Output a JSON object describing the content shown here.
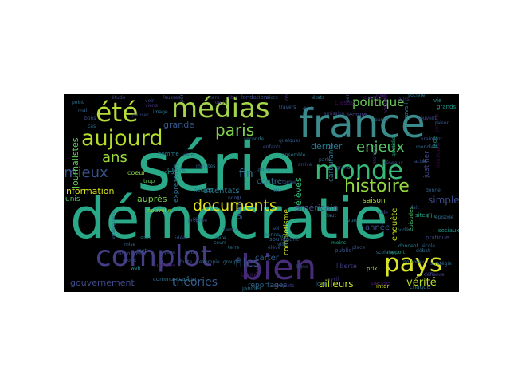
{
  "word_cloud": {
    "words": [
      {
        "text": "série",
        "color": "#2aa988"
      },
      {
        "text": "démocratie",
        "color": "#2aa988"
      },
      {
        "text": "france",
        "color": "#3b8a8c"
      },
      {
        "text": "complot",
        "color": "#433e85"
      },
      {
        "text": "bien",
        "color": "#472c7a"
      },
      {
        "text": "médias",
        "color": "#a3d44a"
      },
      {
        "text": "été",
        "color": "#b7de38"
      },
      {
        "text": "monde",
        "color": "#37b879"
      },
      {
        "text": "pays",
        "color": "#d9e32a"
      },
      {
        "text": "aujourd",
        "color": "#b5de2b"
      },
      {
        "text": "histoire",
        "color": "#94d640"
      },
      {
        "text": "documents",
        "color": "#e2e418"
      },
      {
        "text": "mieux",
        "color": "#3a518a"
      },
      {
        "text": "paris",
        "color": "#7fd34e"
      },
      {
        "text": "enjeux",
        "color": "#56c667"
      },
      {
        "text": "ans",
        "color": "#9bd93c"
      },
      {
        "text": "politique",
        "color": "#6ccd5a"
      },
      {
        "text": "théories",
        "color": "#365c8d"
      },
      {
        "text": "files",
        "color": "#3c508b"
      },
      {
        "text": "vérité",
        "color": "#b5de2b"
      },
      {
        "text": "ailleurs",
        "color": "#c4e021"
      },
      {
        "text": "simple",
        "color": "#3e4989"
      },
      {
        "text": "gouvernement",
        "color": "#3e4a89"
      },
      {
        "text": "information",
        "color": "#d5e21a"
      },
      {
        "text": "journalistes",
        "color": "#67cc5c"
      },
      {
        "text": "américain",
        "color": "#3d4e8a"
      },
      {
        "text": "fin",
        "color": "#2c718e"
      },
      {
        "text": "carter",
        "color": "#355f8d"
      },
      {
        "text": "attentats",
        "color": "#297b8e"
      },
      {
        "text": "grande",
        "color": "#38588c"
      },
      {
        "text": "dernier",
        "color": "#2a768e"
      },
      {
        "text": "élèves",
        "color": "#35b779"
      },
      {
        "text": "contre",
        "color": "#2e6e8e"
      },
      {
        "text": "enquête",
        "color": "#c2df23"
      },
      {
        "text": "année",
        "color": "#3b528b"
      },
      {
        "text": "auprès",
        "color": "#7ad151"
      },
      {
        "text": "reportages",
        "color": "#31688e"
      },
      {
        "text": "saison",
        "color": "#a8db34"
      },
      {
        "text": "carburants",
        "color": "#2b748e"
      },
      {
        "text": "justifier",
        "color": "#3f4788"
      },
      {
        "text": "unis",
        "color": "#4cc26c"
      },
      {
        "text": "ordre",
        "color": "#287c8e"
      },
      {
        "text": "expression",
        "color": "#2d708e"
      },
      {
        "text": "guerre",
        "color": "#3a548c"
      },
      {
        "text": "complotisme",
        "color": "#d2e21b"
      },
      {
        "text": "coeur",
        "color": "#87d549"
      },
      {
        "text": "nouvelle",
        "color": "#8bd646"
      },
      {
        "text": "classe",
        "color": "#471063"
      },
      {
        "text": "jamais",
        "color": "#440154"
      },
      {
        "text": "fondation",
        "color": "#3e4989"
      },
      {
        "text": "liberté",
        "color": "#433d84"
      },
      {
        "text": "janvier",
        "color": "#2c738e"
      },
      {
        "text": "inter",
        "color": "#d0e11c"
      },
      {
        "text": "vie",
        "color": "#20928c"
      },
      {
        "text": "grands",
        "color": "#1e9b8a"
      },
      {
        "text": "homme",
        "color": "#25858e"
      },
      {
        "text": "heures",
        "color": "#26828e"
      },
      {
        "text": "laïcité",
        "color": "#482374"
      },
      {
        "text": "presse",
        "color": "#48186a"
      },
      {
        "text": "prix",
        "color": "#a0da39"
      },
      {
        "text": "film",
        "color": "#1f9f88"
      },
      {
        "text": "sociaux",
        "color": "#1f988b"
      },
      {
        "text": "jour",
        "color": "#2d708e"
      },
      {
        "text": "parti",
        "color": "#1fa088"
      },
      {
        "text": "sites",
        "color": "#21a685"
      },
      {
        "text": "trop",
        "color": "#65cb5e"
      },
      {
        "text": "lecture",
        "color": "#3f4889"
      },
      {
        "text": "épisodes",
        "color": "#4ac16d"
      },
      {
        "text": "lunettes",
        "color": "#482576"
      },
      {
        "text": "communication",
        "color": "#2c728e"
      },
      {
        "text": "pratique",
        "color": "#414487"
      },
      {
        "text": "public",
        "color": "#3b528b"
      },
      {
        "text": "nombreux",
        "color": "#414487"
      },
      {
        "text": "travail",
        "color": "#23888e"
      },
      {
        "text": "violence",
        "color": "#481f70"
      },
      {
        "text": "recherche",
        "color": "#482878"
      },
      {
        "text": "chaque",
        "color": "#2a788e"
      },
      {
        "text": "face",
        "color": "#1e9c89"
      },
      {
        "text": "soulignent",
        "color": "#34618d"
      },
      {
        "text": "avril",
        "color": "#443983"
      },
      {
        "text": "donnent",
        "color": "#24878e"
      },
      {
        "text": "personnes",
        "color": "#3d4d8a"
      },
      {
        "text": "quotidien",
        "color": "#27ad81"
      },
      {
        "text": "alors",
        "color": "#355e8d"
      },
      {
        "text": "fonctionne",
        "color": "#440154"
      },
      {
        "text": "rôle",
        "color": "#482677"
      },
      {
        "text": "permet",
        "color": "#3b528b"
      },
      {
        "text": "bonne",
        "color": "#2f6c8e"
      },
      {
        "text": "montrer",
        "color": "#46337e"
      },
      {
        "text": "aussi",
        "color": "#453781"
      },
      {
        "text": "voir",
        "color": "#3e4989"
      },
      {
        "text": "ville",
        "color": "#2f6b8e"
      },
      {
        "text": "sous",
        "color": "#287d8e"
      },
      {
        "text": "faire",
        "color": "#26828e"
      },
      {
        "text": "web",
        "color": "#1f958b"
      },
      {
        "text": "temps",
        "color": "#33638d"
      },
      {
        "text": "titre",
        "color": "#46327e"
      },
      {
        "text": "actes",
        "color": "#39568c"
      },
      {
        "text": "élève",
        "color": "#3a538b"
      },
      {
        "text": "vrai",
        "color": "#2d718e"
      },
      {
        "text": "cours",
        "color": "#2c738e"
      },
      {
        "text": "faits",
        "color": "#365d8d"
      },
      {
        "text": "moins",
        "color": "#20a386"
      },
      {
        "text": "rapport",
        "color": "#1fa287"
      },
      {
        "text": "terre",
        "color": "#2a778e"
      },
      {
        "text": "société",
        "color": "#2a788e"
      },
      {
        "text": "étude",
        "color": "#3f4788"
      },
      {
        "text": "enseignants",
        "color": "#31678e"
      },
      {
        "text": "viens",
        "color": "#453781"
      },
      {
        "text": "lycée",
        "color": "#3c4f8a"
      },
      {
        "text": "doute",
        "color": "#3c4f8a"
      },
      {
        "text": "exemple",
        "color": "#33638d"
      },
      {
        "text": "idées",
        "color": "#3d4e8a"
      },
      {
        "text": "sens",
        "color": "#2b758e"
      },
      {
        "text": "soir",
        "color": "#365c8d"
      },
      {
        "text": "scolaire",
        "color": "#2e6f8e"
      },
      {
        "text": "vidéo",
        "color": "#2c718e"
      },
      {
        "text": "débat",
        "color": "#2f6c8e"
      },
      {
        "text": "école",
        "color": "#33628d"
      },
      {
        "text": "mars",
        "color": "#3e4a89"
      },
      {
        "text": "minutes",
        "color": "#2e6d8e"
      },
      {
        "text": "fausses",
        "color": "#424086"
      },
      {
        "text": "questions",
        "color": "#48186a"
      },
      {
        "text": "mois",
        "color": "#3d4d8a"
      },
      {
        "text": "travers",
        "color": "#355e8d"
      },
      {
        "text": "ligne",
        "color": "#3b528b"
      },
      {
        "text": "place",
        "color": "#3a538b"
      },
      {
        "text": "nouveau",
        "color": "#2e6f8e"
      },
      {
        "text": "complots",
        "color": "#414487"
      },
      {
        "text": "outil",
        "color": "#443a83"
      },
      {
        "text": "états",
        "color": "#2a788e"
      },
      {
        "text": "propose",
        "color": "#3d4d8a"
      },
      {
        "text": "mise",
        "color": "#33638d"
      },
      {
        "text": "mot",
        "color": "#2f6c8e"
      },
      {
        "text": "projet",
        "color": "#3e4989"
      },
      {
        "text": "groupe",
        "color": "#2c728e"
      },
      {
        "text": "épisode",
        "color": "#31678e"
      },
      {
        "text": "genre",
        "color": "#38598c"
      },
      {
        "text": "forme",
        "color": "#365d8d"
      },
      {
        "text": "lieu",
        "color": "#2e6e8e"
      },
      {
        "text": "nom",
        "color": "#3b518b"
      },
      {
        "text": "vue",
        "color": "#2d718e"
      },
      {
        "text": "faut",
        "color": "#2b748e"
      },
      {
        "text": "aide",
        "color": "#424086"
      },
      {
        "text": "fait",
        "color": "#3a548c"
      },
      {
        "text": "donne",
        "color": "#34608d"
      },
      {
        "text": "ensemble",
        "color": "#297a8e"
      },
      {
        "text": "enfants",
        "color": "#3c508b"
      },
      {
        "text": "seconde",
        "color": "#2c728e"
      },
      {
        "text": "quelques",
        "color": "#355f8d"
      },
      {
        "text": "arrive",
        "color": "#3e4a89"
      },
      {
        "text": "parle",
        "color": "#2b758e"
      },
      {
        "text": "grand",
        "color": "#32648e"
      },
      {
        "text": "réseaux",
        "color": "#3b528b"
      },
      {
        "text": "mondiale",
        "color": "#2e6d8e"
      },
      {
        "text": "vraiment",
        "color": "#39568c"
      },
      {
        "text": "droit",
        "color": "#2f6b8e"
      },
      {
        "text": "emission",
        "color": "#424186"
      },
      {
        "text": "défiance",
        "color": "#3f4889"
      },
      {
        "text": "stratégie",
        "color": "#2e6e8e"
      },
      {
        "text": "passé",
        "color": "#34608d"
      },
      {
        "text": "souvent",
        "color": "#3d4e8a"
      },
      {
        "text": "raison",
        "color": "#365c8d"
      },
      {
        "text": "image",
        "color": "#2a788e"
      },
      {
        "text": "penser",
        "color": "#3e4a89"
      },
      {
        "text": "point",
        "color": "#2d708e"
      },
      {
        "text": "mal",
        "color": "#33638d"
      },
      {
        "text": "bons",
        "color": "#3a548c"
      },
      {
        "text": "cas",
        "color": "#2c728e"
      }
    ]
  }
}
